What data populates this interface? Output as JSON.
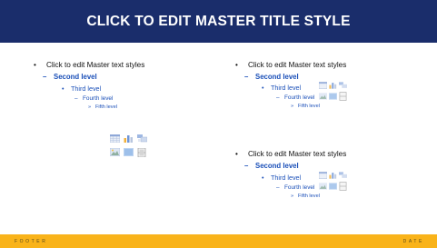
{
  "slide": {
    "title": "CLICK TO EDIT MASTER TITLE STYLE",
    "footer": "FOOTER",
    "date": "DATE"
  },
  "placeholders": [
    {
      "levels": [
        {
          "bullet": "•",
          "text": "Click to edit Master text styles"
        },
        {
          "bullet": "–",
          "text": "Second level"
        },
        {
          "bullet": "•",
          "text": "Third level"
        },
        {
          "bullet": "–",
          "text": "Fourth level"
        },
        {
          "bullet": "»",
          "text": "Fifth level"
        }
      ]
    },
    {
      "levels": [
        {
          "bullet": "•",
          "text": "Click to edit Master text styles"
        },
        {
          "bullet": "–",
          "text": "Second level"
        },
        {
          "bullet": "•",
          "text": "Third level"
        },
        {
          "bullet": "–",
          "text": "Fourth level"
        },
        {
          "bullet": "»",
          "text": "Fifth level"
        }
      ]
    },
    {
      "levels": [
        {
          "bullet": "•",
          "text": "Click to edit Master text styles"
        },
        {
          "bullet": "–",
          "text": "Second level"
        },
        {
          "bullet": "•",
          "text": "Third level"
        },
        {
          "bullet": "–",
          "text": "Fourth level"
        },
        {
          "bullet": "»",
          "text": "Fifth level"
        }
      ]
    }
  ],
  "content_icons": [
    "insert-table-icon",
    "insert-chart-icon",
    "insert-smartart-icon",
    "insert-picture-icon",
    "insert-online-picture-icon",
    "insert-video-icon"
  ],
  "colors": {
    "title_bar": "#1a2d6b",
    "footer_bar": "#f9b31a",
    "accent_text": "#1a4fb8"
  }
}
